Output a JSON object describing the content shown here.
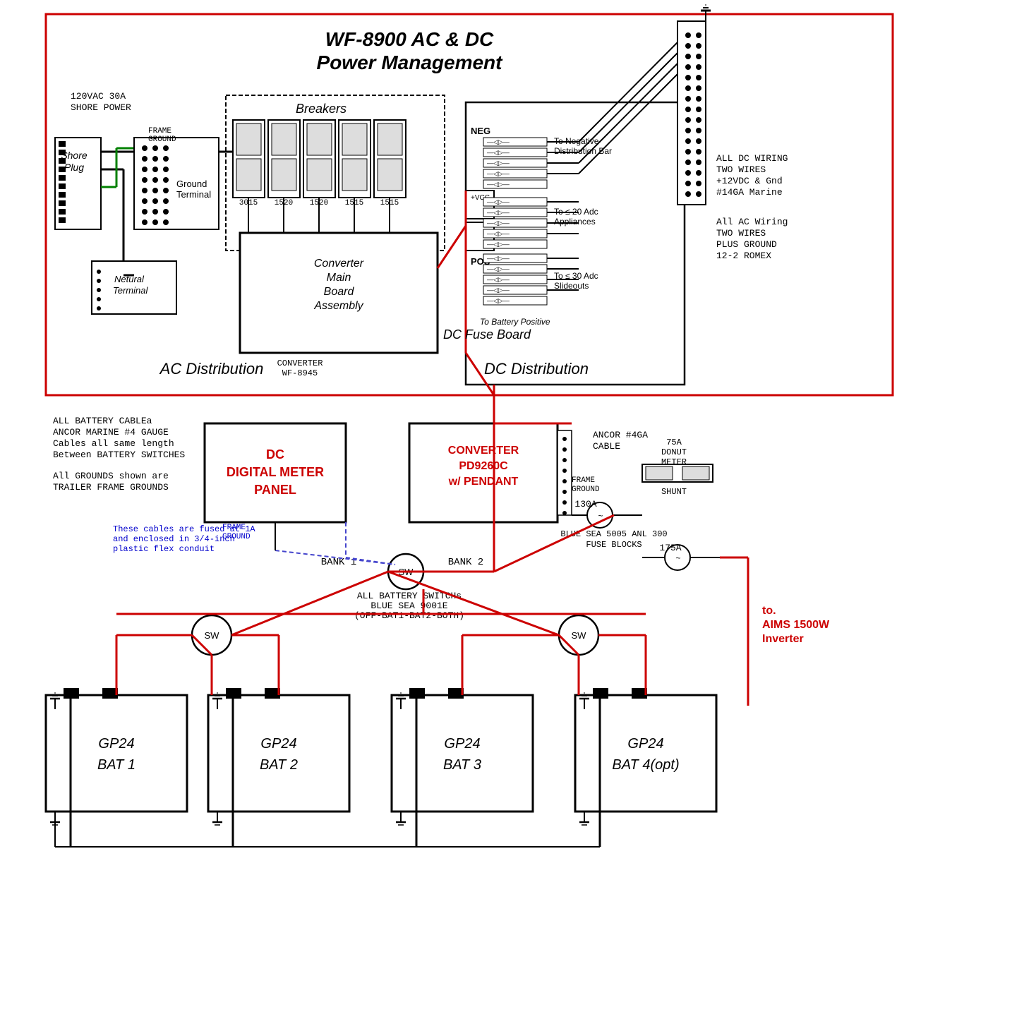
{
  "title": "WF-8900 AC & DC Power Management",
  "diagram": {
    "main_title_line1": "WF-8900 AC & DC",
    "main_title_line2": "Power Management",
    "sections": {
      "ac_distribution": "AC Distribution",
      "dc_distribution": "DC Distribution"
    },
    "labels": {
      "shore_power": "120VAC 30A\nSHORE POWER",
      "shore_plug": "Shore\nPlug",
      "frame_ground": "FRAME\nGROUND",
      "ground_terminal": "Ground\nTerminal",
      "neutral_terminal": "Netural\nTerminal",
      "breakers": "Breakers",
      "converter_main": "Converter\nMain\nBoard\nAssembly",
      "converter_label": "CONVERTER\nWF-8945",
      "to_neg_dist": "To Negative\nDistribution Bar",
      "to_20adc": "To ≤ 20 Adc\nAppliances",
      "to_30adc": "To ≤ 30 Adc\nSlideouts",
      "to_bat_pos": "To Battery Positive",
      "dc_fuse_board": "DC Fuse Board",
      "neg": "NEG",
      "pos": "POS",
      "vcc": "+VCC",
      "breaker_values": [
        "3015",
        "1520",
        "1520",
        "1515",
        "1515"
      ],
      "dc_wiring_note": "ALL DC WIRING\nTWO WIRES\n+12VDC & Gnd\n#14GA Marine",
      "ac_wiring_note": "All AC Wiring\nTWO WIRES\nPLUS GROUND\n12-2 ROMEX",
      "battery_cables_note": "ALL BATTERY CABLEa\nANCOR MARINE #4 GAUGE\nCables all same length\nBetween BATTERY SWITCHES",
      "grounds_note": "All GROUNDS shown are\nTRAILER FRAME GROUNDS",
      "fused_note": "These cables are fused at 1A\nand enclosed in 3/4-inch\nplastic flex conduit",
      "frame_ground2": "FRAME\nGROUND",
      "dc_meter_panel": "DC\nDIGITAL METER\nPANEL",
      "converter_pd": "CONVERTER\nPD9260C\nw/ PENDANT",
      "ancor_cable": "ANCOR #4GA\nCABLE",
      "donut_meter": "75A\nDONUT\nMETER\nSHUNT",
      "fuse_130a": "130A\nBLUE SEA 5005 ANL 300\nFUSE BLOCKS",
      "fuse_175a": "175A",
      "bank1": "BANK 1",
      "bank2": "BANK 2",
      "sw": "SW",
      "battery_switches": "ALL BATTERY SWITCHs\nBLUE SEA 9001E\n(OFF-BAT1-BAT2-BOTH)",
      "aims_inverter": "to.\nAIMS 1500W\nInverter",
      "bat1": "GP24\nBAT 1",
      "bat2": "GP24\nBAT 2",
      "bat3": "GP24\nBAT 3",
      "bat4": "GP24\nBAT 4(opt)"
    },
    "colors": {
      "red_border": "#cc0000",
      "black": "#000000",
      "red": "#cc0000",
      "green": "#008000",
      "blue": "#0000cc",
      "gray": "#888888",
      "white": "#ffffff",
      "dc_meter_red": "#cc0000",
      "converter_red": "#cc0000",
      "aims_red": "#cc0000"
    }
  }
}
